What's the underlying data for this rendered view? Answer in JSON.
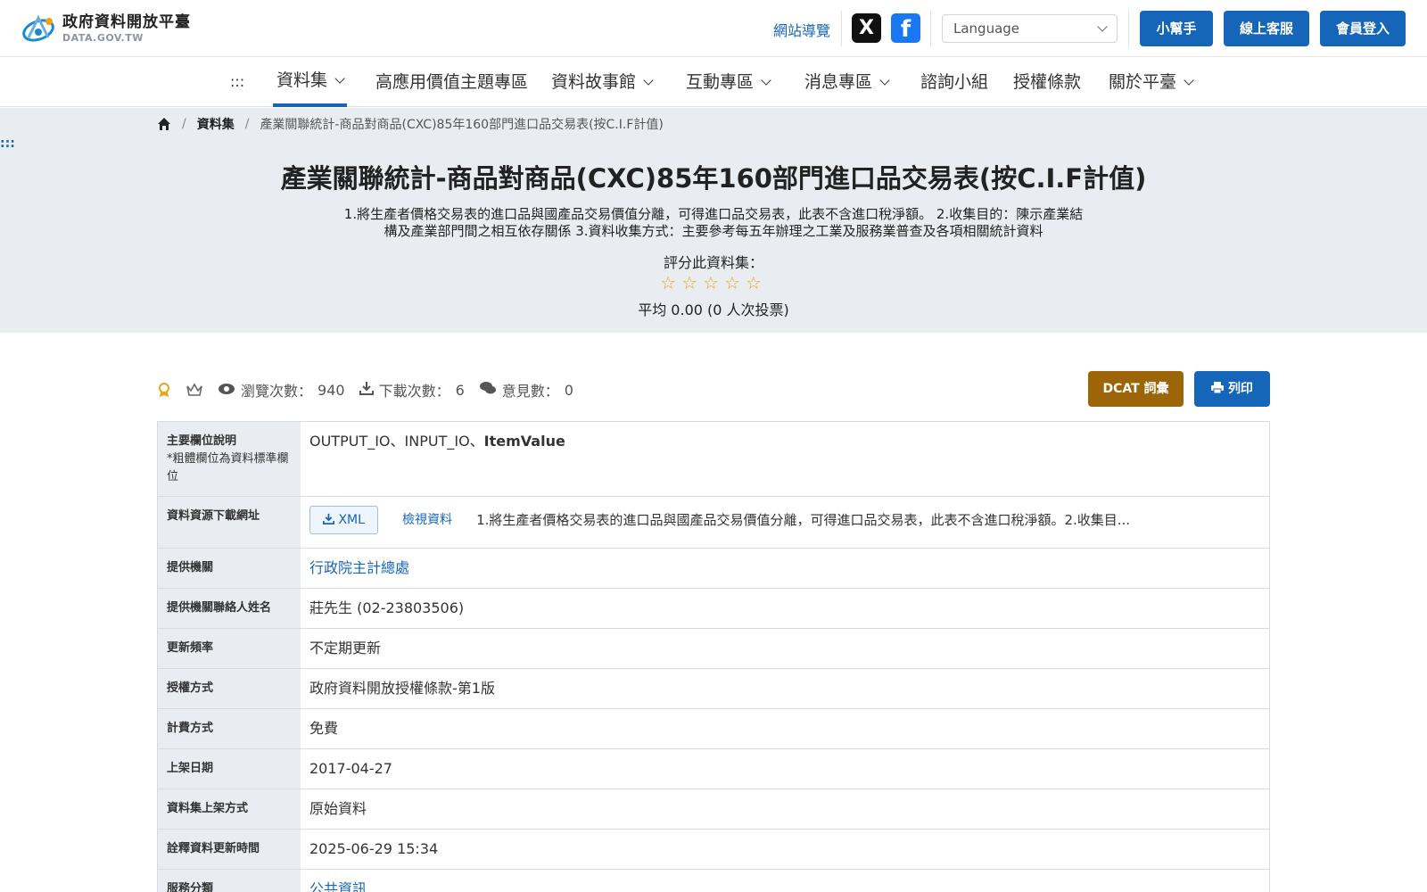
{
  "header": {
    "logo_cn": "政府資料開放平臺",
    "logo_en": "DATA.GOV.TW",
    "sitemap": "網站導覽",
    "x_icon": "X",
    "fb_icon": "f",
    "language_placeholder": "Language",
    "helper": "小幫手",
    "support": "線上客服",
    "login": "會員登入"
  },
  "nav": {
    "menu_icon": ":::",
    "items": [
      "資料集",
      "高應用價值主題專區",
      "資料故事館",
      "互動專區",
      "消息專區",
      "諮詢小組",
      "授權條款",
      "關於平臺"
    ]
  },
  "breadcrumb": {
    "datasets": "資料集",
    "current": "產業關聯統計-商品對商品(CXC)85年160部門進口品交易表(按C.I.F計值)"
  },
  "skip_link": ":::",
  "dataset": {
    "title": "產業關聯統計-商品對商品(CXC)85年160部門進口品交易表(按C.I.F計值)",
    "description": "1.將生產者價格交易表的進口品與國產品交易價值分離，可得進口品交易表，此表不含進口稅淨額。 2.收集目的：陳示產業結構及產業部門間之相互依存關係 3.資料收集方式：主要參考每五年辦理之工業及服務業普查及各項相關統計資料",
    "rate_label": "評分此資料集：",
    "stars": "☆☆☆☆☆",
    "average": "平均 0.00 (0 人次投票)"
  },
  "stats": {
    "views_label": "瀏覽次數：",
    "views": "940",
    "downloads_label": "下載次數：",
    "downloads": "6",
    "comments_label": "意見數：",
    "comments": "0",
    "dcat": "DCAT 詞彙",
    "print": "列印"
  },
  "table": {
    "fields_label": "主要欄位說明",
    "fields_note": "*粗體欄位為資料標準欄位",
    "fields_plain": "OUTPUT_IO、INPUT_IO、",
    "fields_bold": "ItemValue",
    "resource_label": "資料資源下載網址",
    "xml": "XML",
    "view_data": "檢視資料",
    "resource_desc": "1.將生產者價格交易表的進口品與國產品交易價值分離，可得進口品交易表，此表不含進口稅淨額。2.收集目...",
    "rows": [
      {
        "label": "提供機關",
        "value": "行政院主計總處",
        "link": true
      },
      {
        "label": "提供機關聯絡人姓名",
        "value": "莊先生 (02-23803506)",
        "link": false
      },
      {
        "label": "更新頻率",
        "value": "不定期更新",
        "link": false
      },
      {
        "label": "授權方式",
        "value": "政府資料開放授權條款-第1版",
        "link": false
      },
      {
        "label": "計費方式",
        "value": "免費",
        "link": false
      },
      {
        "label": "上架日期",
        "value": "2017-04-27",
        "link": false
      },
      {
        "label": "資料集上架方式",
        "value": "原始資料",
        "link": false
      },
      {
        "label": "詮釋資料更新時間",
        "value": "2025-06-29 15:34",
        "link": false
      },
      {
        "label": "服務分類",
        "value": "公共資訊",
        "link": true
      }
    ]
  }
}
